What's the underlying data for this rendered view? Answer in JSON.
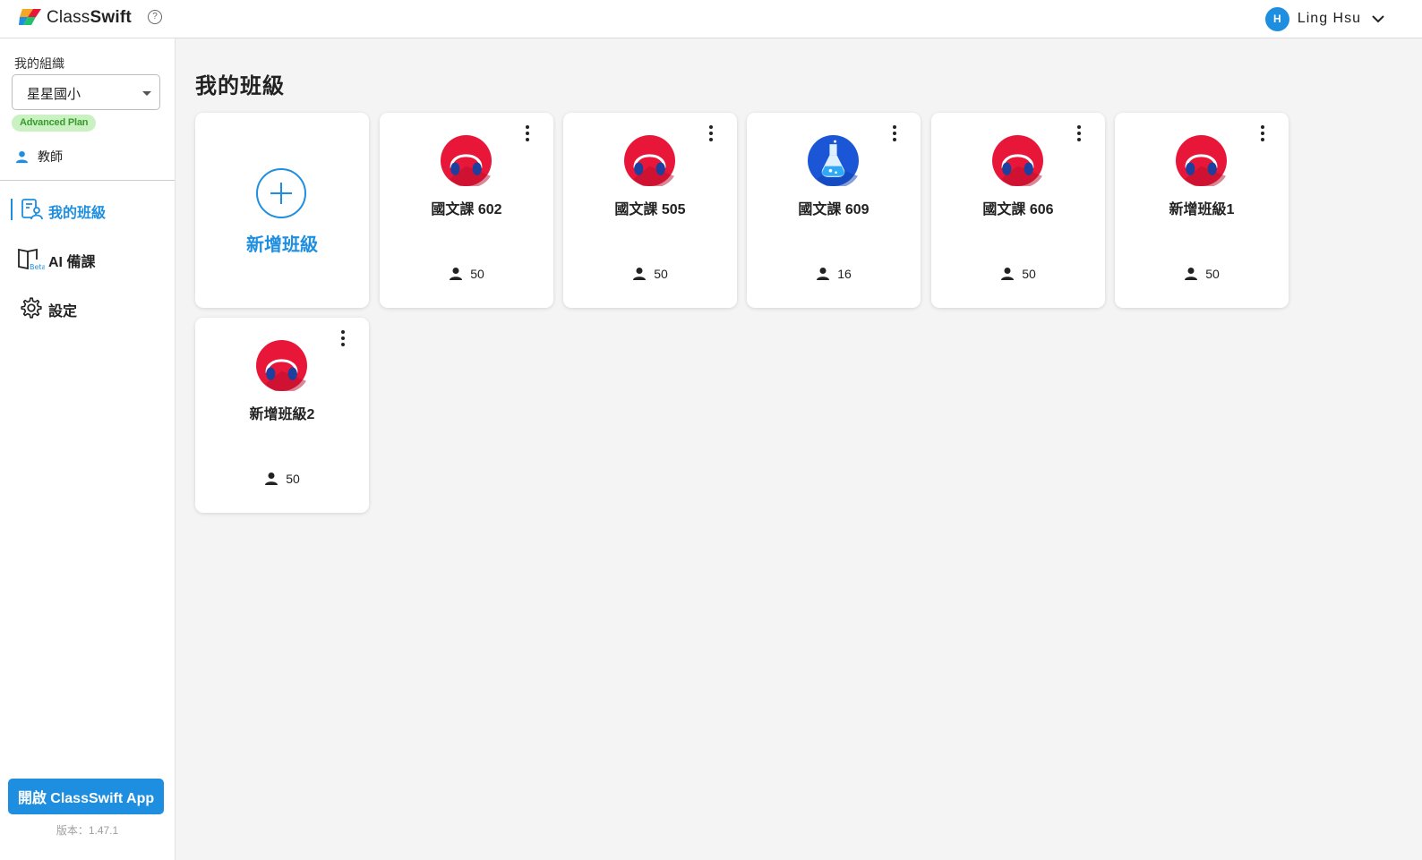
{
  "header": {
    "brand_class": "Class",
    "brand_swift": "Swift",
    "help_label": "?",
    "user_initial": "H",
    "user_name": "Ling Hsu"
  },
  "sidebar": {
    "org_label": "我的組織",
    "org_value": "星星國小",
    "plan": "Advanced Plan",
    "role": "教師",
    "nav": [
      {
        "label": "我的班級",
        "icon": "classroom-icon",
        "active": true
      },
      {
        "label": "AI 備課",
        "icon": "ai-book-icon",
        "badge": "Beta",
        "active": false
      },
      {
        "label": "設定",
        "icon": "gear-icon",
        "active": false
      }
    ],
    "open_app_label": "開啟 ClassSwift App",
    "version": "版本：1.47.1"
  },
  "main": {
    "title": "我的班級",
    "add_label": "新增班級",
    "classes": [
      {
        "name": "國文課 602",
        "count": "50",
        "icon": "headphones-icon"
      },
      {
        "name": "國文課 505",
        "count": "50",
        "icon": "headphones-icon"
      },
      {
        "name": "國文課 609",
        "count": "16",
        "icon": "flask-icon"
      },
      {
        "name": "國文課 606",
        "count": "50",
        "icon": "headphones-icon"
      },
      {
        "name": "新增班級1",
        "count": "50",
        "icon": "headphones-icon"
      },
      {
        "name": "新增班級2",
        "count": "50",
        "icon": "headphones-icon"
      }
    ]
  },
  "colors": {
    "accent": "#1e8fe0",
    "plan_bg": "#c9f1c2",
    "plan_text": "#3a9a2e",
    "headphones_bg": "#e8173a",
    "flask_bg": "#1a56d6"
  }
}
